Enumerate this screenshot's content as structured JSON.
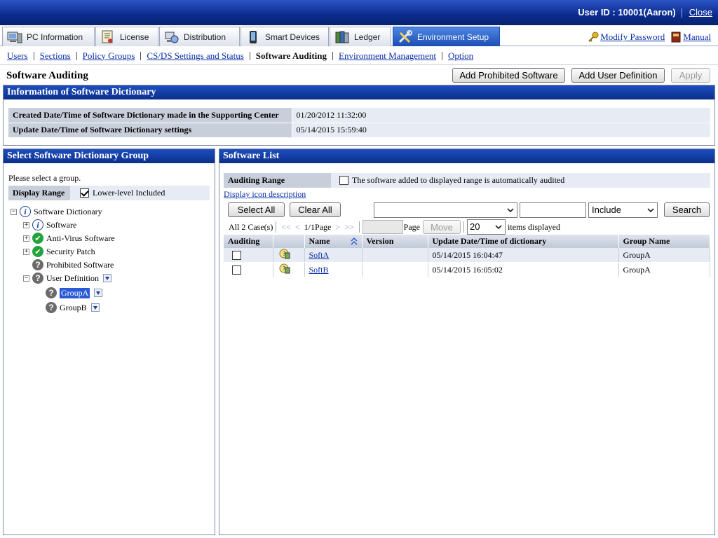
{
  "header": {
    "user_label": "User ID : 10001(Aaron)",
    "close_label": "Close"
  },
  "tabs": [
    {
      "label": "PC Information",
      "icon": "pc-icon"
    },
    {
      "label": "License",
      "icon": "license-icon"
    },
    {
      "label": "Distribution",
      "icon": "distribution-icon"
    },
    {
      "label": "Smart Devices",
      "icon": "smart-device-icon"
    },
    {
      "label": "Ledger",
      "icon": "ledger-icon"
    },
    {
      "label": "Environment Setup",
      "icon": "tools-icon",
      "active": true
    }
  ],
  "toplinks": {
    "modify_password": "Modify Password",
    "manual": "Manual"
  },
  "subnav": [
    "Users",
    "Sections",
    "Policy Groups",
    "CS/DS Settings and Status",
    "Software Auditing",
    "Environment Management",
    "Option"
  ],
  "page": {
    "title": "Software Auditing",
    "btn_add_prohibited": "Add Prohibited Software",
    "btn_add_user_def": "Add User Definition",
    "btn_apply": "Apply"
  },
  "dict_info": {
    "title": "Information of Software Dictionary",
    "rows": [
      {
        "label": "Created Date/Time of Software Dictionary made in the Supporting Center",
        "value": "01/20/2012 11:32:00"
      },
      {
        "label": "Update Date/Time of Software Dictionary settings",
        "value": "05/14/2015 15:59:40"
      }
    ]
  },
  "group_panel": {
    "title": "Select Software Dictionary Group",
    "prompt": "Please select a group.",
    "display_range_label": "Display Range",
    "lower_level_label": "Lower-level Included",
    "tree": {
      "root": "Software Dictionary",
      "software": "Software",
      "antivirus": "Anti-Virus Software",
      "security_patch": "Security Patch",
      "prohibited": "Prohibited Software",
      "user_definition": "User Definition",
      "group_a": "GroupA",
      "group_b": "GroupB"
    }
  },
  "list_panel": {
    "title": "Software List",
    "auditing_range_label": "Auditing Range",
    "auto_audit_label": "The software added to displayed range is automatically audited",
    "icon_desc_link": "Display icon description",
    "btn_select_all": "Select All",
    "btn_clear_all": "Clear All",
    "filter_field_value": "",
    "filter_text_value": "",
    "filter_mode": "Include",
    "btn_search": "Search",
    "pager": {
      "count": "All 2 Case(s)",
      "first": "<<",
      "prev": "<",
      "page_info": "1/1Page",
      "next": ">",
      "last": ">>",
      "page_label": "Page",
      "btn_move": "Move",
      "per_page": "20",
      "items_label": "items displayed"
    },
    "columns": [
      "Auditing",
      "",
      "Name",
      "Version",
      "Update Date/Time of dictionary",
      "Group Name"
    ],
    "rows": [
      {
        "name": "SoftA",
        "version": "",
        "updated": "05/14/2015 16:04:47",
        "group": "GroupA"
      },
      {
        "name": "SoftB",
        "version": "",
        "updated": "05/14/2015 16:05:02",
        "group": "GroupA"
      }
    ]
  }
}
